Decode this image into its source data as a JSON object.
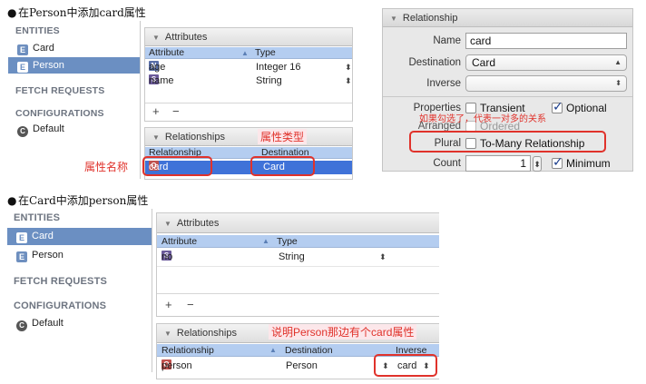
{
  "bullets": {
    "one": "在Person中添加card属性",
    "two": "在Card中添加person属性"
  },
  "sidebar": {
    "entities_header": "ENTITIES",
    "fetch_header": "FETCH REQUESTS",
    "configurations_header": "CONFIGURATIONS",
    "entity_icon": "E",
    "config_icon": "C",
    "top_entities": [
      "Card",
      "Person"
    ],
    "bottom_entities": [
      "Card",
      "Person"
    ],
    "config_default": "Default"
  },
  "top_editor": {
    "attributes_header": "Attributes",
    "attr_cols": {
      "attribute": "Attribute",
      "type": "Type"
    },
    "attr_rows": [
      {
        "tag": "N",
        "name": "age",
        "type": "Integer 16"
      },
      {
        "tag": "S",
        "name": "name",
        "type": "String"
      }
    ],
    "add": "+",
    "remove": "−",
    "relationships_header": "Relationships",
    "rel_cols": {
      "relationship": "Relationship",
      "destination": "Destination"
    },
    "rel_row": {
      "tag": "O",
      "name": "card",
      "destination": "Card"
    }
  },
  "bottom_editor": {
    "attributes_header": "Attributes",
    "attr_cols": {
      "attribute": "Attribute",
      "type": "Type"
    },
    "attr_rows": [
      {
        "tag": "S",
        "name": "no",
        "type": "String"
      }
    ],
    "add": "+",
    "remove": "−",
    "relationships_header": "Relationships",
    "rel_cols": {
      "relationship": "Relationship",
      "destination": "Destination",
      "inverse": "Inverse"
    },
    "rel_row": {
      "tag": "O",
      "name": "person",
      "destination": "Person",
      "inverse": "card"
    }
  },
  "inspector": {
    "header": "Relationship",
    "name_label": "Name",
    "name_value": "card",
    "destination_label": "Destination",
    "destination_value": "Card",
    "inverse_label": "Inverse",
    "inverse_value": "",
    "properties_label": "Properties",
    "transient_label": "Transient",
    "transient_checked": false,
    "optional_label": "Optional",
    "optional_checked": true,
    "arranged_label": "Arranged",
    "ordered_label": "Ordered",
    "plural_label": "Plural",
    "to_many_label": "To-Many Relationship",
    "to_many_checked": false,
    "count_label": "Count",
    "count_value": "1",
    "minimum_label": "Minimum",
    "minimum_checked": true
  },
  "annotations": {
    "attr_name": "属性名称",
    "attr_type": "属性类型",
    "to_many_note": "如果勾选了，代表一对多的关系",
    "inverse_note": "说明Person那边有个card属性"
  },
  "colors": {
    "annotation_red": "#e0322b",
    "selection_blue": "#3f72d8",
    "sidebar_selection": "#6b8fc2"
  }
}
